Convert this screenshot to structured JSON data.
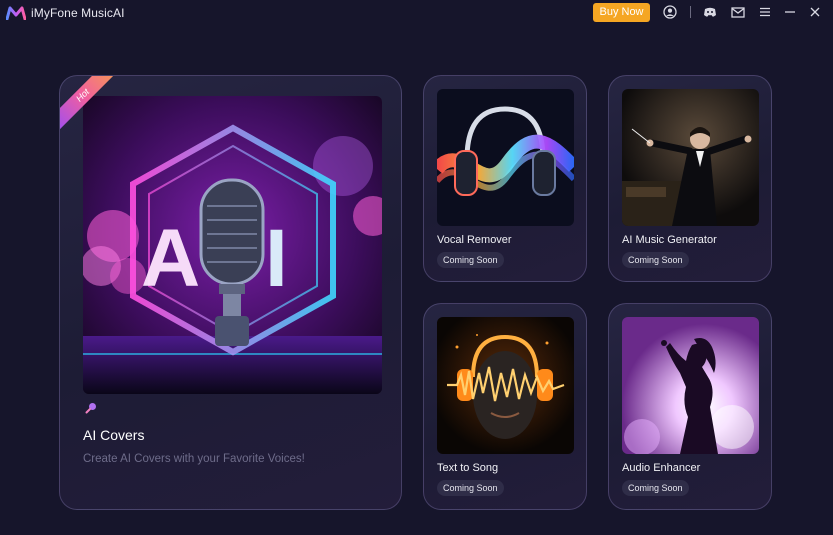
{
  "app": {
    "title": "iMyFone MusicAI",
    "buy_now_label": "Buy Now"
  },
  "titlebar_icons": [
    "account-icon",
    "discord-icon",
    "mail-icon",
    "menu-icon",
    "minimize-icon",
    "close-icon"
  ],
  "featured": {
    "badge": "Hot",
    "title": "AI Covers",
    "description": "Create AI Covers with your Favorite Voices!"
  },
  "tools": [
    {
      "title": "Vocal Remover",
      "status": "Coming Soon"
    },
    {
      "title": "AI Music Generator",
      "status": "Coming Soon"
    },
    {
      "title": "Text to Song",
      "status": "Coming Soon"
    },
    {
      "title": "Audio Enhancer",
      "status": "Coming Soon"
    }
  ],
  "colors": {
    "background": "#16152b",
    "accent_orange": "#f5a623",
    "card_border": "#5a5480",
    "muted_text": "#6e6c8a"
  }
}
